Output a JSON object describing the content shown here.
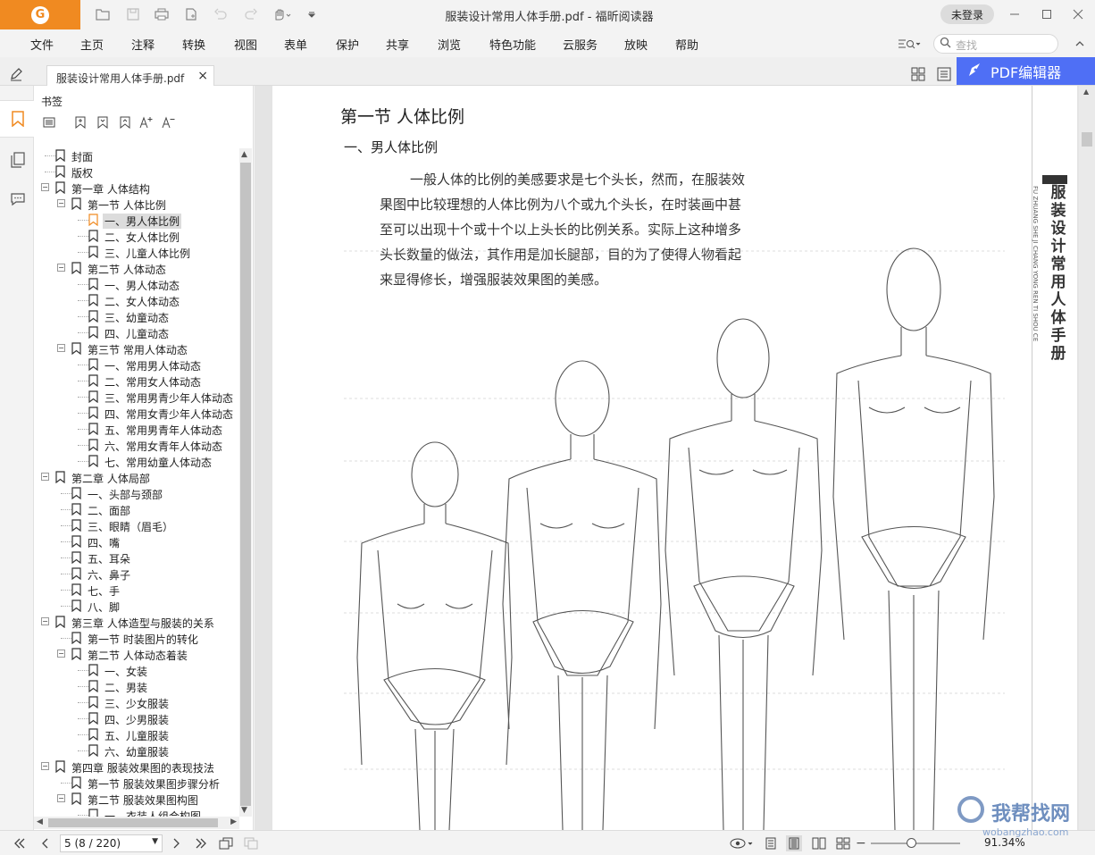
{
  "titlebar": {
    "window_title": "服装设计常用人体手册.pdf - 福昕阅读器",
    "login_label": "未登录",
    "logo_letter": "G"
  },
  "menu": {
    "items": [
      "文件",
      "主页",
      "注释",
      "转换",
      "视图",
      "表单",
      "保护",
      "共享",
      "浏览",
      "特色功能",
      "云服务",
      "放映",
      "帮助"
    ]
  },
  "search": {
    "placeholder": "查找"
  },
  "tab": {
    "label": "服装设计常用人体手册.pdf",
    "close": "×"
  },
  "pdf_editor_label": "PDF编辑器",
  "bookmarks": {
    "title": "书签",
    "items": [
      {
        "label": "封面",
        "level": 0,
        "toggle": ""
      },
      {
        "label": "版权",
        "level": 0,
        "toggle": ""
      },
      {
        "label": "第一章  人体结构",
        "level": 0,
        "toggle": "−"
      },
      {
        "label": "第一节  人体比例",
        "level": 1,
        "toggle": "−"
      },
      {
        "label": "一、男人体比例",
        "level": 2,
        "toggle": "",
        "selected": true
      },
      {
        "label": "二、女人体比例",
        "level": 2,
        "toggle": ""
      },
      {
        "label": "三、儿童人体比例",
        "level": 2,
        "toggle": ""
      },
      {
        "label": "第二节  人体动态",
        "level": 1,
        "toggle": "−"
      },
      {
        "label": "一、男人体动态",
        "level": 2,
        "toggle": ""
      },
      {
        "label": "二、女人体动态",
        "level": 2,
        "toggle": ""
      },
      {
        "label": "三、幼童动态",
        "level": 2,
        "toggle": ""
      },
      {
        "label": "四、儿童动态",
        "level": 2,
        "toggle": ""
      },
      {
        "label": "第三节  常用人体动态",
        "level": 1,
        "toggle": "−"
      },
      {
        "label": "一、常用男人体动态",
        "level": 2,
        "toggle": ""
      },
      {
        "label": "二、常用女人体动态",
        "level": 2,
        "toggle": ""
      },
      {
        "label": "三、常用男青少年人体动态",
        "level": 2,
        "toggle": ""
      },
      {
        "label": "四、常用女青少年人体动态",
        "level": 2,
        "toggle": ""
      },
      {
        "label": "五、常用男青年人体动态",
        "level": 2,
        "toggle": ""
      },
      {
        "label": "六、常用女青年人体动态",
        "level": 2,
        "toggle": ""
      },
      {
        "label": "七、常用幼童人体动态",
        "level": 2,
        "toggle": ""
      },
      {
        "label": "第二章  人体局部",
        "level": 0,
        "toggle": "−"
      },
      {
        "label": "一、头部与颈部",
        "level": 1,
        "toggle": ""
      },
      {
        "label": "二、面部",
        "level": 1,
        "toggle": ""
      },
      {
        "label": "三、眼睛（眉毛）",
        "level": 1,
        "toggle": ""
      },
      {
        "label": "四、嘴",
        "level": 1,
        "toggle": ""
      },
      {
        "label": "五、耳朵",
        "level": 1,
        "toggle": ""
      },
      {
        "label": "六、鼻子",
        "level": 1,
        "toggle": ""
      },
      {
        "label": "七、手",
        "level": 1,
        "toggle": ""
      },
      {
        "label": "八、脚",
        "level": 1,
        "toggle": ""
      },
      {
        "label": "第三章  人体造型与服装的关系",
        "level": 0,
        "toggle": "−"
      },
      {
        "label": "第一节  时装图片的转化",
        "level": 1,
        "toggle": ""
      },
      {
        "label": "第二节  人体动态着装",
        "level": 1,
        "toggle": "−"
      },
      {
        "label": "一、女装",
        "level": 2,
        "toggle": ""
      },
      {
        "label": "二、男装",
        "level": 2,
        "toggle": ""
      },
      {
        "label": "三、少女服装",
        "level": 2,
        "toggle": ""
      },
      {
        "label": "四、少男服装",
        "level": 2,
        "toggle": ""
      },
      {
        "label": "五、儿童服装",
        "level": 2,
        "toggle": ""
      },
      {
        "label": "六、幼童服装",
        "level": 2,
        "toggle": ""
      },
      {
        "label": "第四章  服装效果图的表现技法",
        "level": 0,
        "toggle": "−"
      },
      {
        "label": "第一节  服装效果图步骤分析",
        "level": 1,
        "toggle": ""
      },
      {
        "label": "第二节  服装效果图构图",
        "level": 1,
        "toggle": "−"
      },
      {
        "label": "一、衣装人组合构图",
        "level": 2,
        "toggle": ""
      }
    ]
  },
  "page": {
    "heading1": "第一节    人体比例",
    "heading2": "一、男人体比例",
    "paragraph_lines": [
      "一般人体的比例的美感要求是七个头长，然而，在服装效",
      "果图中比较理想的人体比例为八个或九个头长，在时装画中甚",
      "至可以出现十个或十个以上头长的比例关系。实际上这种增多",
      "头长数量的做法，其作用是加长腿部，目的为了使得人物看起",
      "来显得修长，增强服装效果图的美感。"
    ],
    "side_title": "服装设计常用人体手册",
    "side_pinyin": "FU ZHUANG SHE JI CHANG YONG REN TI SHOU CE"
  },
  "bottom": {
    "page_display": "5 (8 / 220)",
    "zoom": "91.34%",
    "zoom_fraction": 0.45
  },
  "watermark": {
    "text": "我帮找网",
    "url": "wobangzhao.com"
  }
}
